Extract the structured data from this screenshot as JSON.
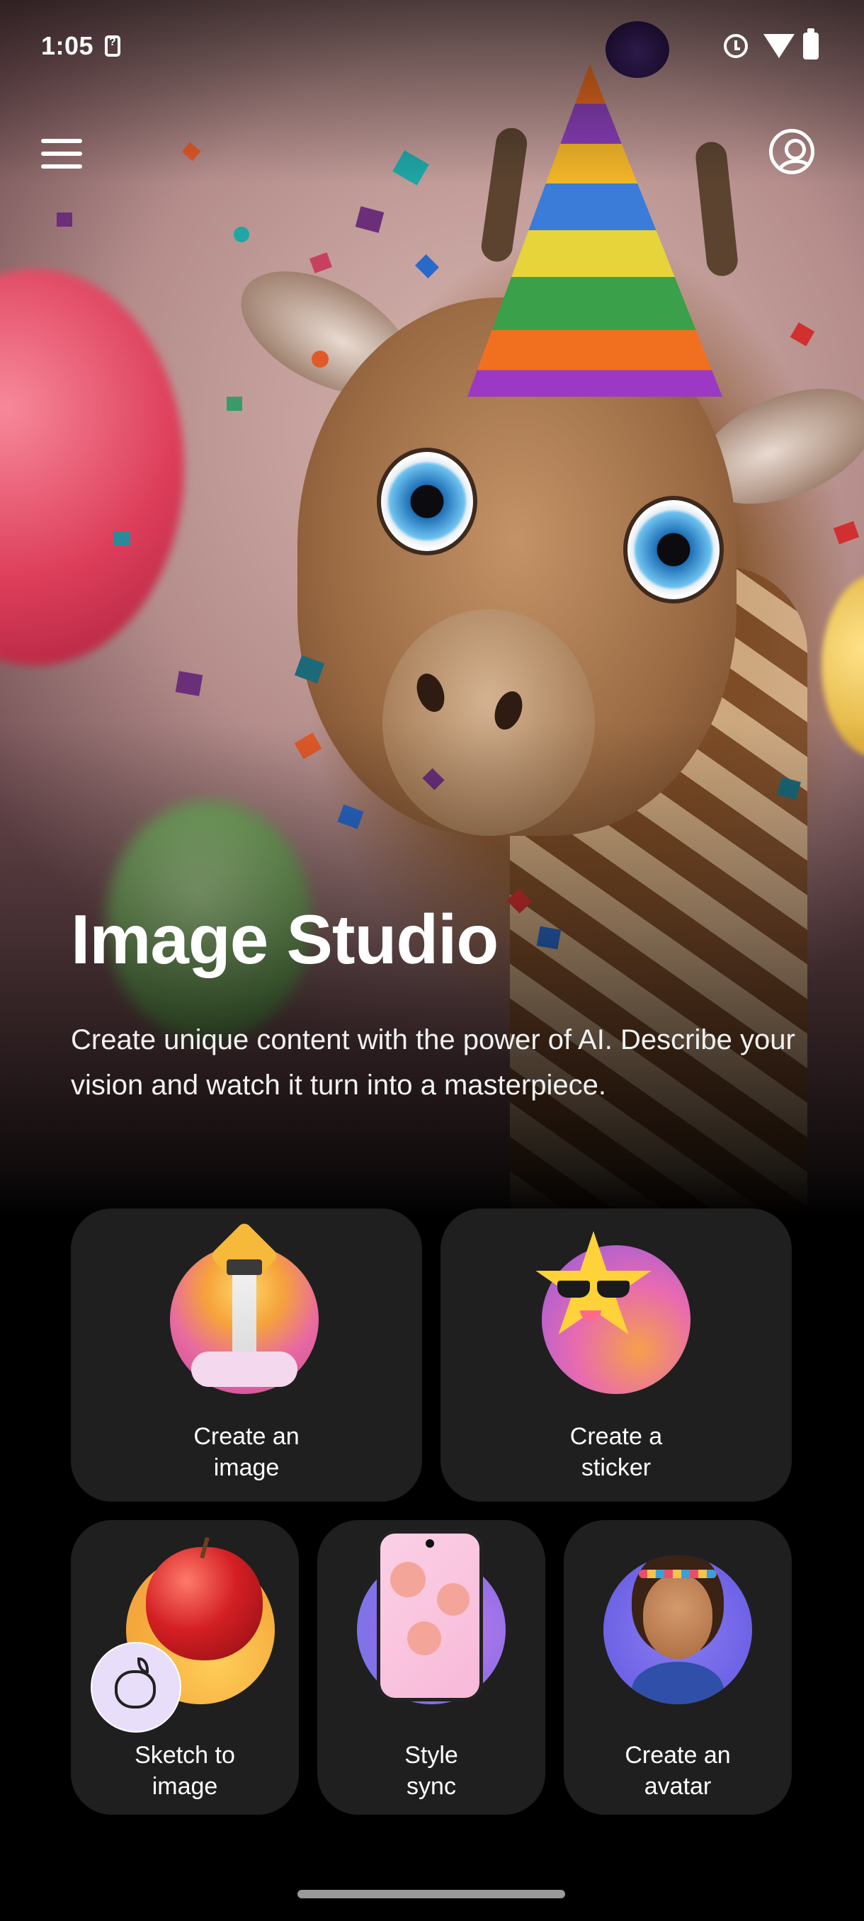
{
  "status_bar": {
    "time": "1:05",
    "icons": [
      "sim-question-icon",
      "alarm-icon",
      "wifi-icon",
      "battery-icon"
    ]
  },
  "app_bar": {
    "menu_icon": "menu-icon",
    "account_icon": "account-circle-icon"
  },
  "hero": {
    "title": "Image Studio",
    "description": "Create unique content with the power of AI. Describe your vision and watch it turn into a masterpiece."
  },
  "cards": [
    {
      "id": "create-image",
      "label_lines": [
        "Create an",
        "image"
      ],
      "art": "lighthouse-illustration"
    },
    {
      "id": "create-sticker",
      "label_lines": [
        "Create a",
        "sticker"
      ],
      "art": "star-sunglasses-illustration"
    },
    {
      "id": "sketch-to-image",
      "label_lines": [
        "Sketch to",
        "image"
      ],
      "art": "apple-illustration"
    },
    {
      "id": "style-sync",
      "label_lines": [
        "Style",
        "sync"
      ],
      "art": "phone-illustration"
    },
    {
      "id": "create-avatar",
      "label_lines": [
        "Create an",
        "avatar"
      ],
      "art": "avatar-illustration"
    }
  ],
  "colors": {
    "background": "#000000",
    "card": "#1f1f1f",
    "text": "#ffffff"
  }
}
